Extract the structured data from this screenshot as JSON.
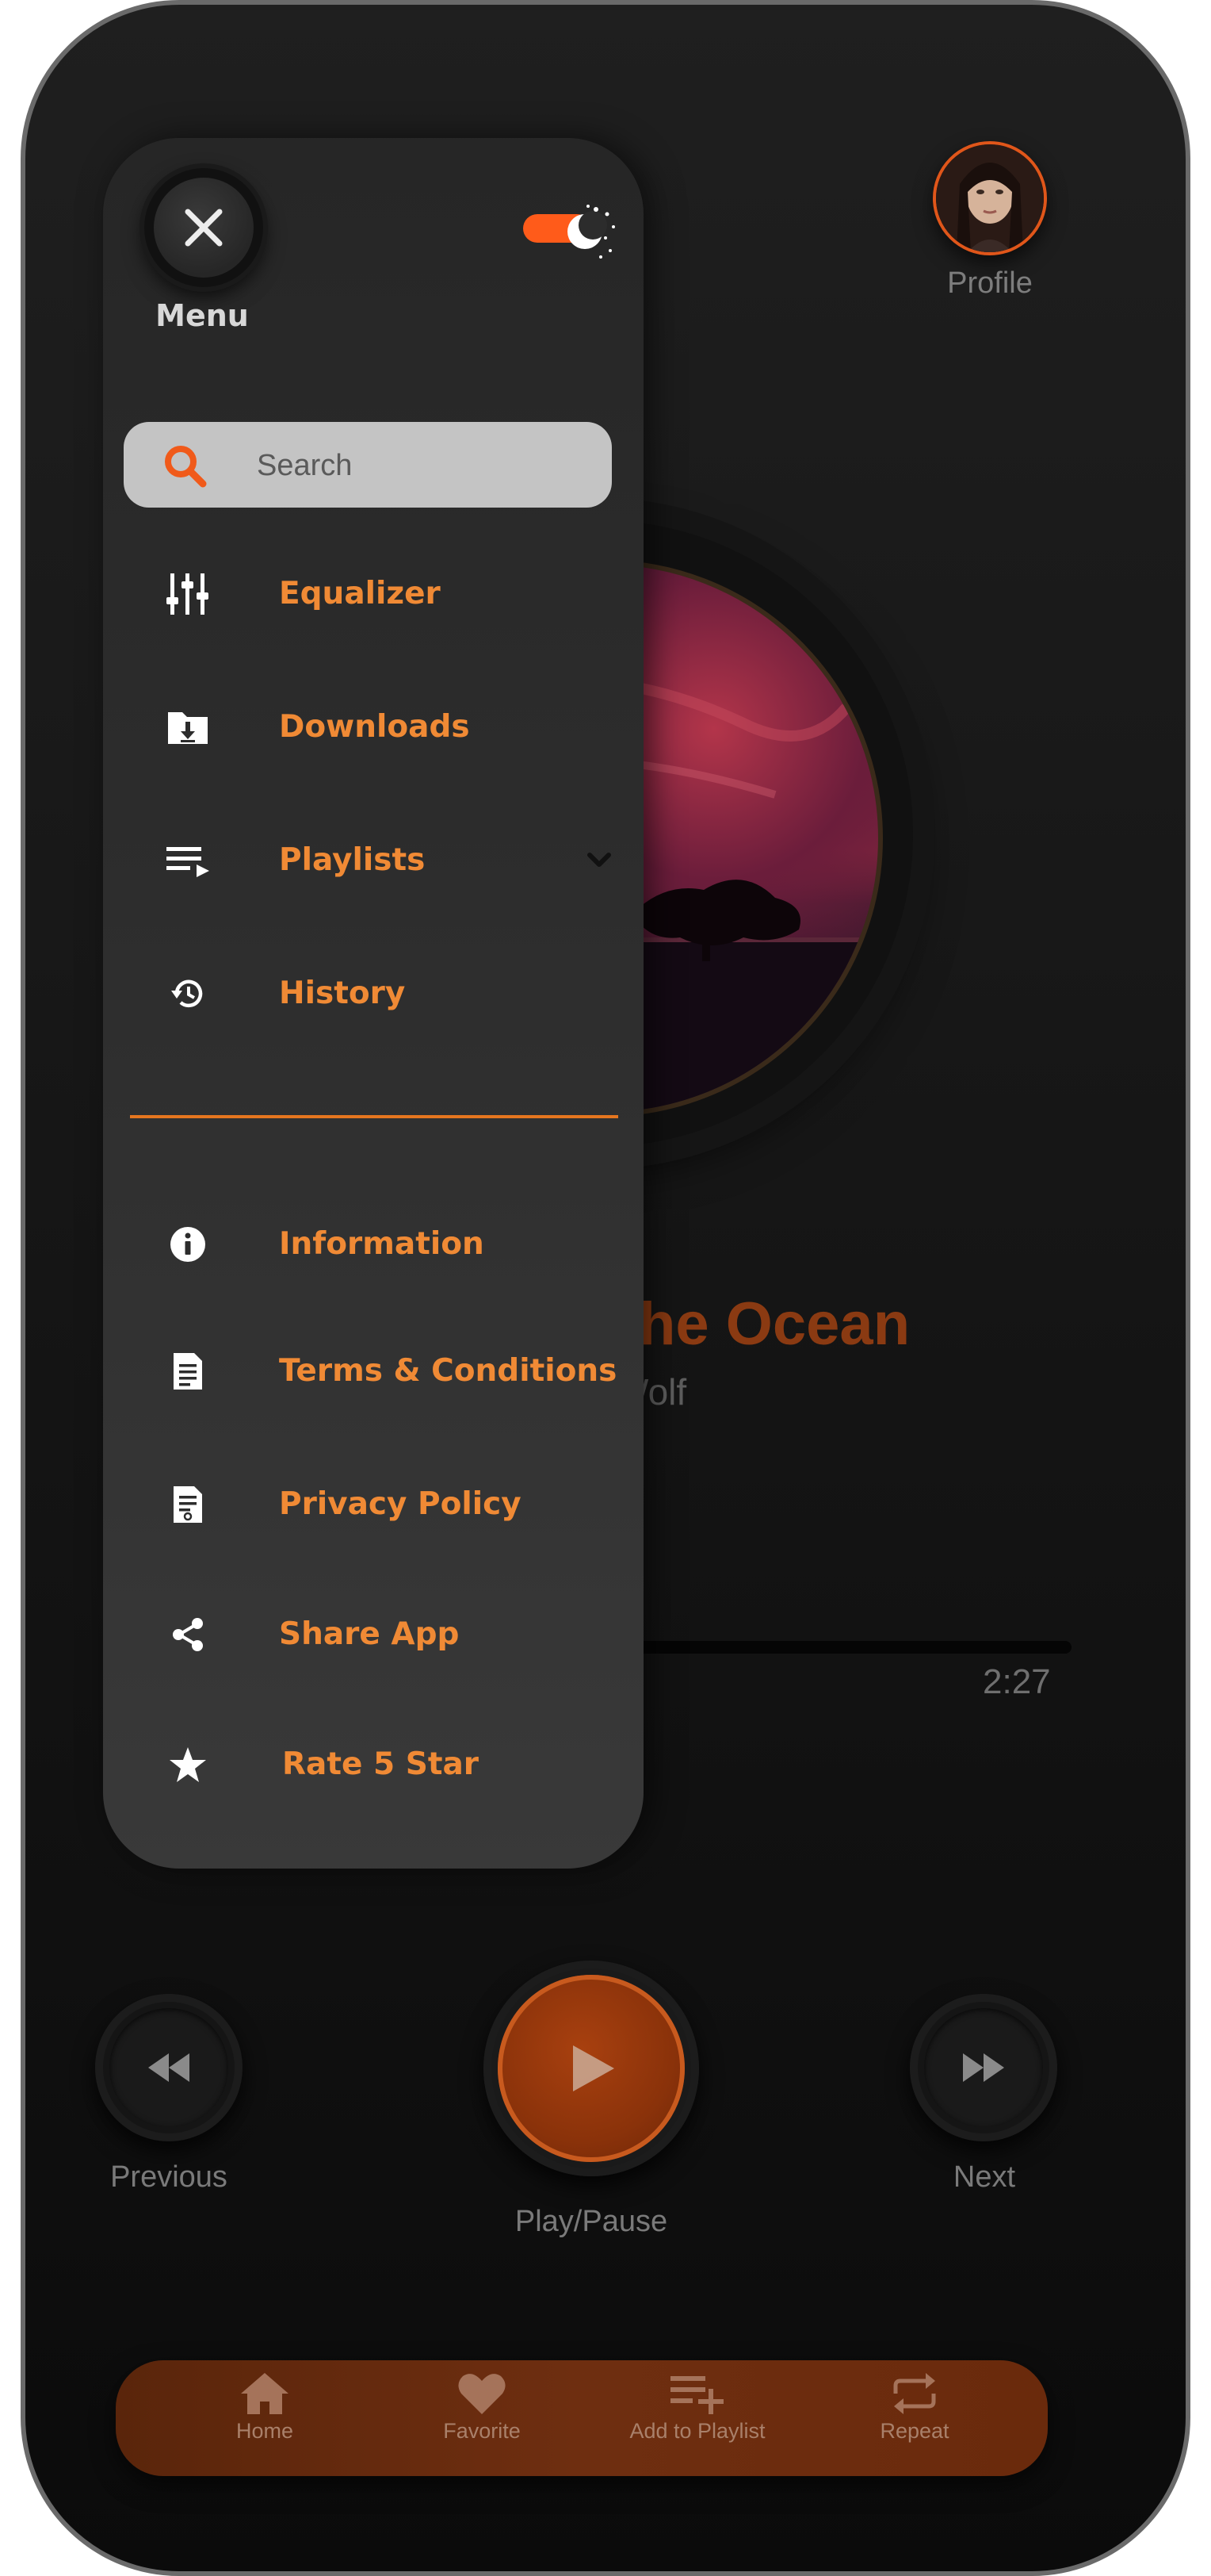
{
  "profile": {
    "label": "Profile"
  },
  "now_playing": {
    "title": "n The Ocean",
    "artist": "l Wolf",
    "time_end": "2:27"
  },
  "controls": {
    "previous": "Previous",
    "play_pause": "Play/Pause",
    "next": "Next"
  },
  "bottom_nav": [
    {
      "label": "Home",
      "icon": "home-icon"
    },
    {
      "label": "Favorite",
      "icon": "heart-icon"
    },
    {
      "label": "Add to Playlist",
      "icon": "playlist-add-icon"
    },
    {
      "label": "Repeat",
      "icon": "repeat-icon"
    }
  ],
  "drawer": {
    "menu_label": "Menu",
    "search": {
      "placeholder": "Search"
    },
    "items": [
      {
        "label": "Equalizer",
        "icon": "equalizer-icon"
      },
      {
        "label": "Downloads",
        "icon": "downloads-folder-icon"
      },
      {
        "label": "Playlists",
        "icon": "playlist-icon"
      },
      {
        "label": "History",
        "icon": "history-icon"
      }
    ],
    "secondary_items": [
      {
        "label": "Information",
        "icon": "info-icon"
      },
      {
        "label": "Terms & Conditions",
        "icon": "document-icon"
      },
      {
        "label": "Privacy Policy",
        "icon": "policy-document-icon"
      },
      {
        "label": "Share App",
        "icon": "share-icon"
      },
      {
        "label": "Rate 5 Star",
        "icon": "star-icon"
      }
    ]
  },
  "colors": {
    "accent": "#f08a35",
    "toggle": "#ff5b1a",
    "background": "#1a1a1a",
    "drawer": "#2e2e2e",
    "nav_bar": "#6a2a0c"
  }
}
